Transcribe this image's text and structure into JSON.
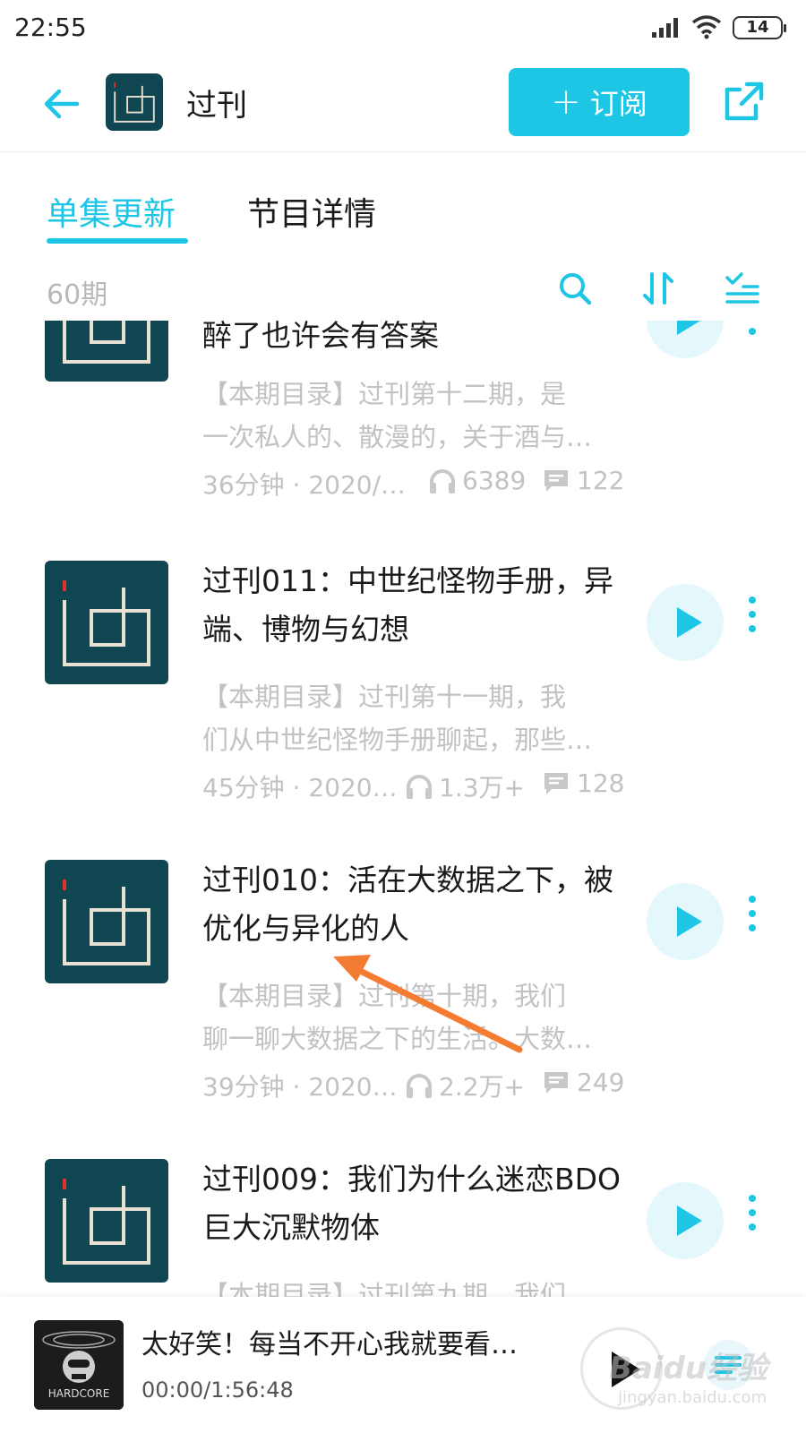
{
  "status_bar": {
    "time": "22:55",
    "battery": "14",
    "icons": [
      "signal-icon",
      "wifi-icon",
      "battery-icon"
    ]
  },
  "header": {
    "back_icon": "arrow-left-icon",
    "logo_text": "过刊",
    "title": "过刊",
    "subscribe_label": "订阅",
    "subscribe_icon": "plus-icon",
    "share_icon": "share-icon",
    "accent_color": "#1ec6e6"
  },
  "tabs": [
    {
      "label": "单集更新",
      "active": true
    },
    {
      "label": "节目详情",
      "active": false
    }
  ],
  "toolbar": {
    "episode_count": "60期",
    "icons": [
      "search-icon",
      "sort-icon",
      "filter-list-icon"
    ]
  },
  "episodes": [
    {
      "title": "醉了也许会有答案",
      "desc_lines": [
        "【本期目录】过刊第十二期，是",
        "一次私人的、散漫的，关于酒与…"
      ],
      "duration_date": "36分钟 · 2020/…",
      "listens": "6389",
      "comments": "122"
    },
    {
      "title": "过刊011：中世纪怪物手册，异端、博物与幻想",
      "desc_lines": [
        "【本期目录】过刊第十一期，我",
        "们从中世纪怪物手册聊起，那些…"
      ],
      "duration_date": "45分钟 · 2020…",
      "listens": "1.3万+",
      "comments": "128"
    },
    {
      "title": "过刊010：活在大数据之下，被优化与异化的人",
      "desc_lines": [
        "【本期目录】过刊第十期，我们",
        "聊一聊大数据之下的生活。大数…"
      ],
      "duration_date": "39分钟 · 2020…",
      "listens": "2.2万+",
      "comments": "249"
    },
    {
      "title": "过刊009：我们为什么迷恋BDO巨大沉默物体",
      "desc_lines": [
        "【本期目录】过刊第九期，我们",
        ""
      ],
      "duration_date": "",
      "listens": "",
      "comments": ""
    }
  ],
  "player": {
    "title": "太好笑！每当不开心我就要看…",
    "time": "00:00/1:56:48",
    "cover_text": "HARDCORE",
    "play_icon": "play-icon",
    "playlist_icon": "playlist-icon"
  },
  "watermark": {
    "text": "Baidu经验",
    "sub": "jingyan.baidu.com"
  },
  "annotation_color": "#f47b32"
}
